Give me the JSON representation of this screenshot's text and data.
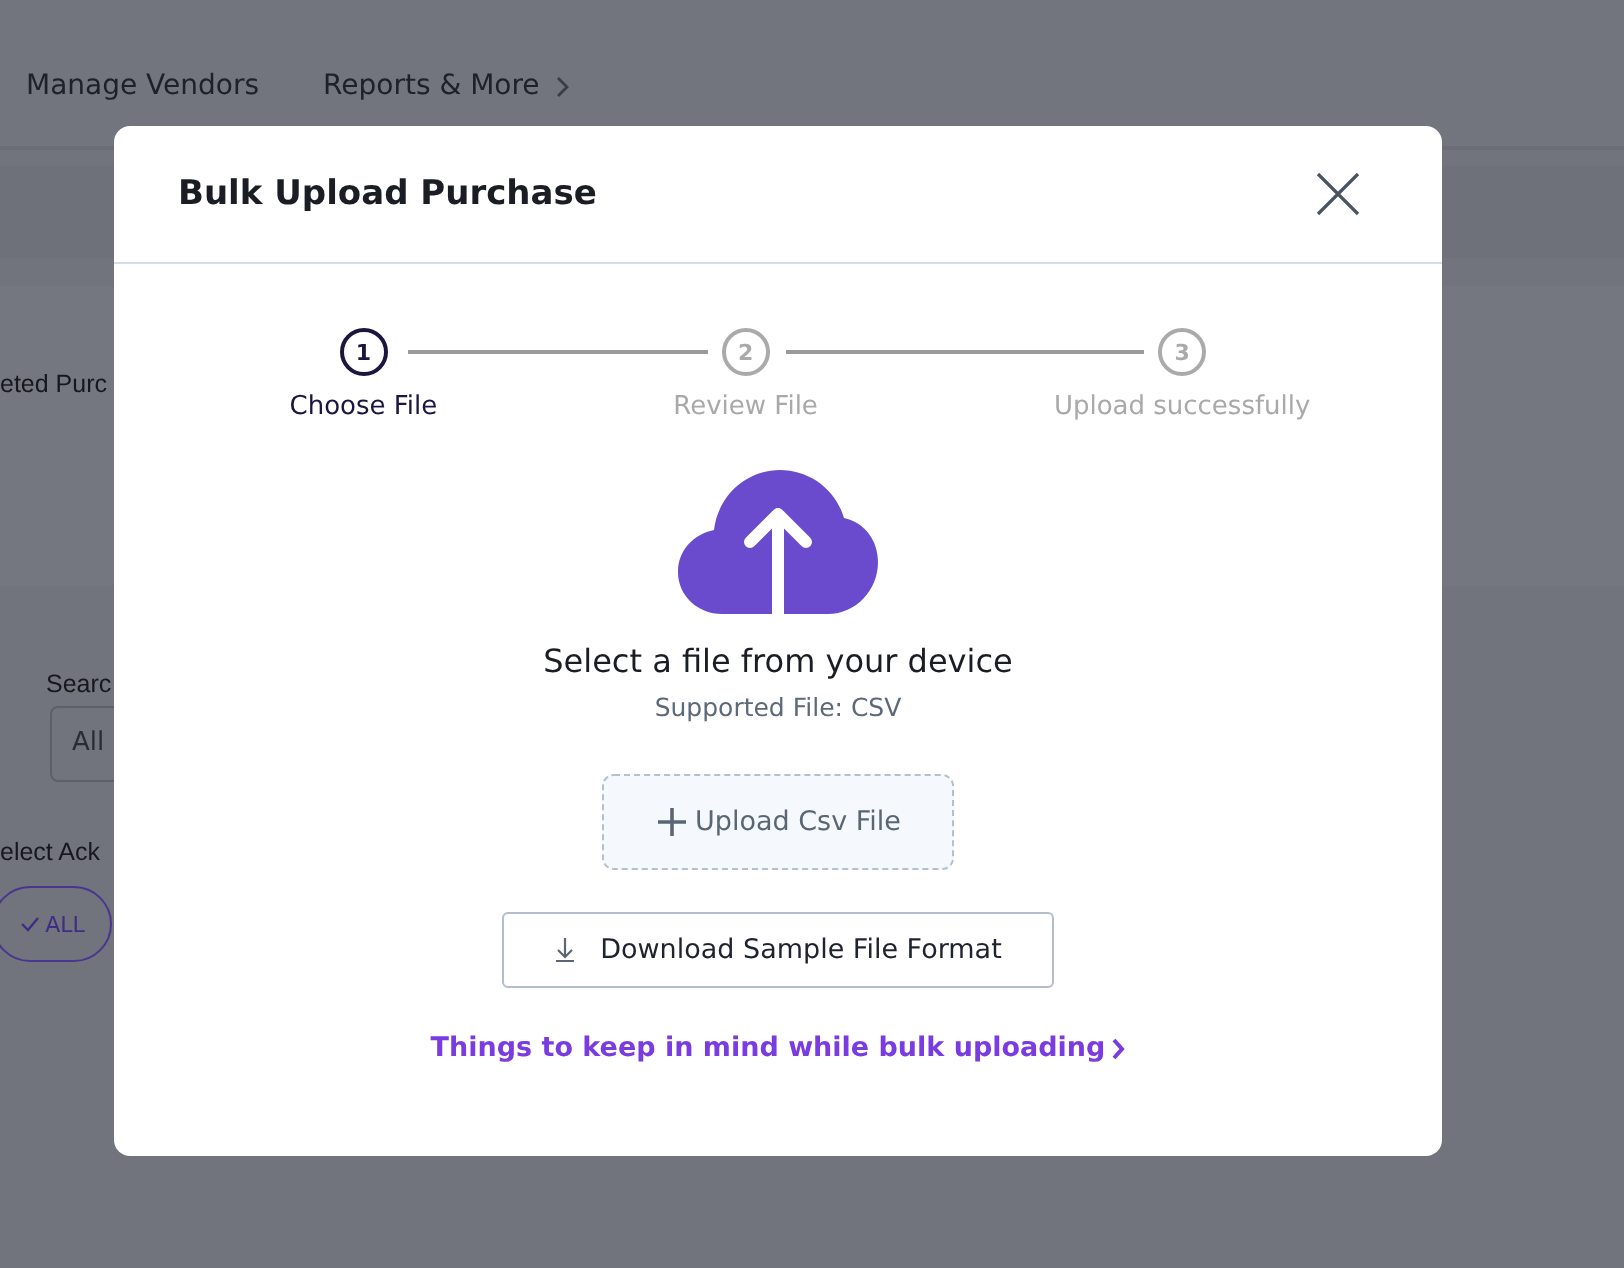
{
  "background": {
    "nav": [
      {
        "label": "Manage Vendors",
        "kind": "link"
      },
      {
        "label": "Reports & More",
        "kind": "menu"
      }
    ],
    "tab_label": "eted Purc",
    "search_label": "Searc",
    "search_field": {
      "value": "All"
    },
    "filter_label": "elect Ack",
    "filter_chip": {
      "label": "ALL",
      "checked": true
    }
  },
  "modal": {
    "title": "Bulk Upload Purchase",
    "steps": [
      {
        "number": "1",
        "label": "Choose File",
        "selected": true
      },
      {
        "number": "2",
        "label": "Review File",
        "selected": false
      },
      {
        "number": "3",
        "label": "Upload successfully",
        "selected": false
      }
    ],
    "prompt": "Select a file from your device",
    "supported": "Supported File: CSV",
    "upload_button": "Upload Csv File",
    "download_button": "Download Sample File Format",
    "help_link": "Things to keep in mind while bulk uploading"
  }
}
